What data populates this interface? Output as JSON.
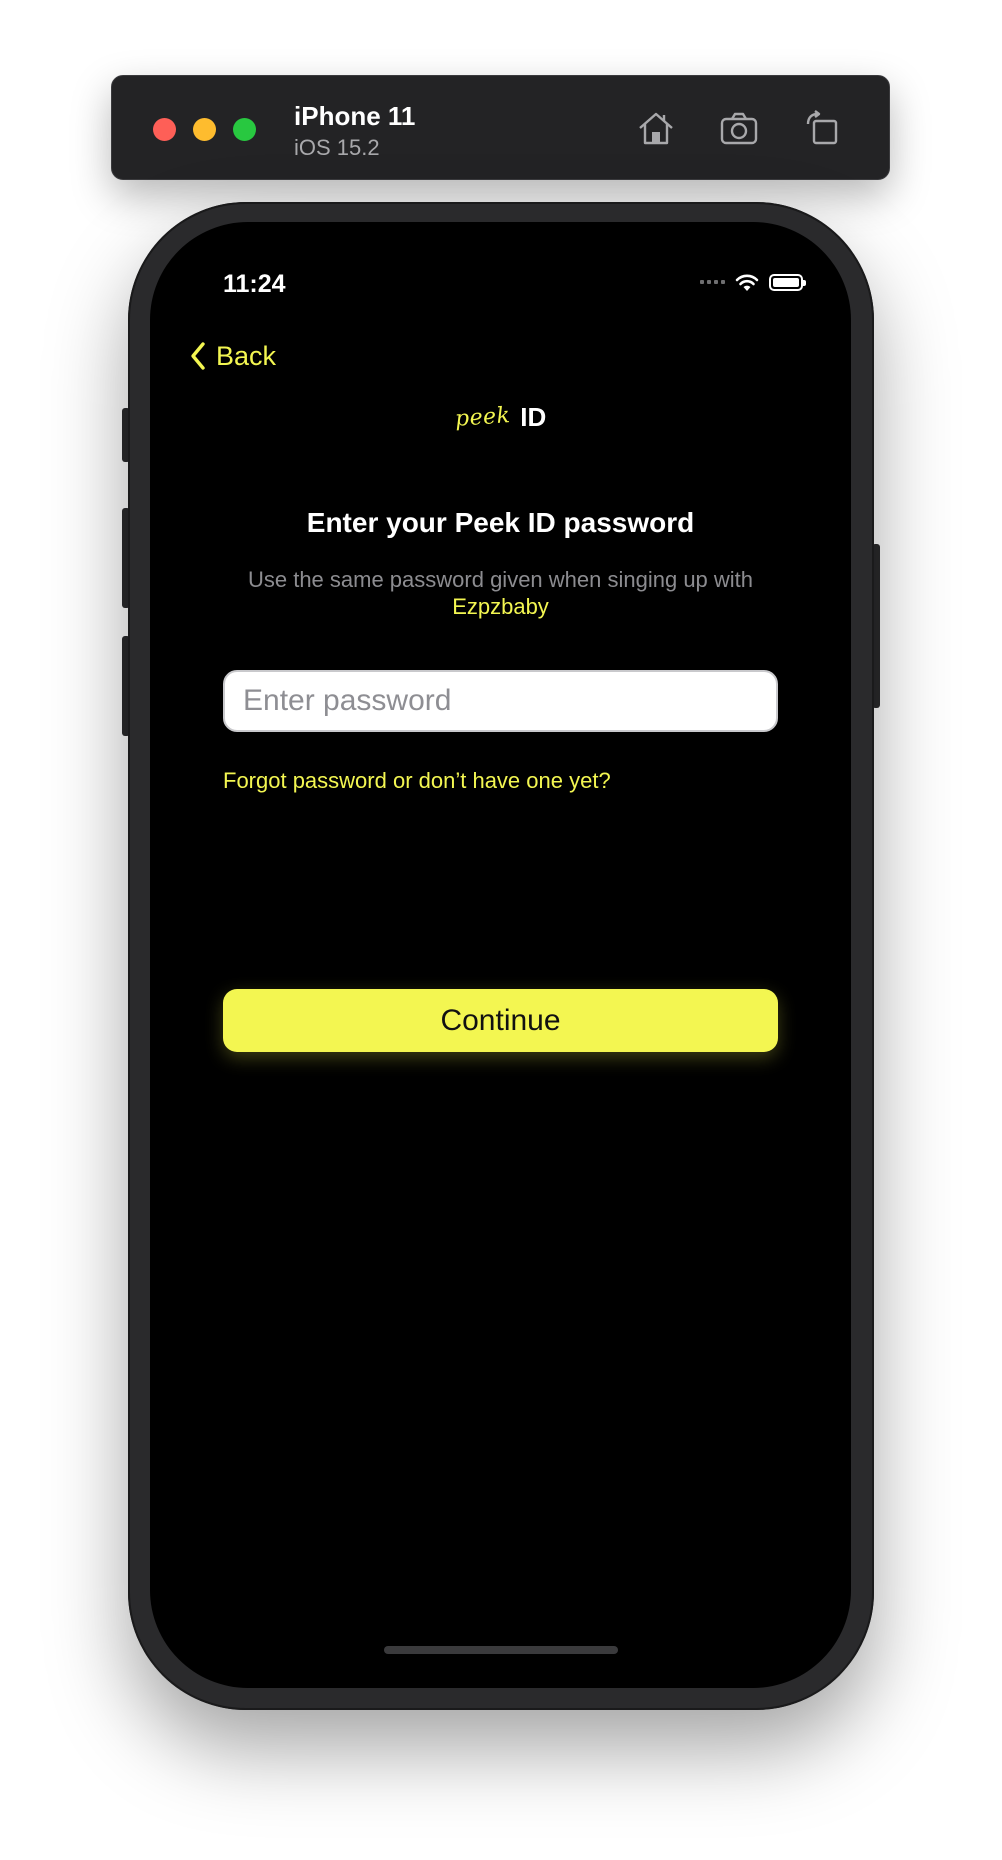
{
  "simulator": {
    "device_name": "iPhone 11",
    "os_version": "iOS 15.2",
    "icons": [
      "home-icon",
      "screenshot-icon",
      "rotate-icon"
    ]
  },
  "status_bar": {
    "time": "11:24",
    "icons": [
      "signal-icon",
      "wifi-icon",
      "battery-icon"
    ]
  },
  "nav": {
    "back_label": "Back"
  },
  "logo": {
    "script": "peek",
    "id": "ID"
  },
  "content": {
    "title": "Enter your Peek ID password",
    "subtitle_text": "Use the same password given when singing up with",
    "subtitle_brand": "Ezpzbaby",
    "password_placeholder": "Enter password",
    "forgot_link": "Forgot password or don’t have one yet?",
    "continue_label": "Continue"
  },
  "colors": {
    "accent": "#f3f651",
    "background": "#000000",
    "toolbar": "#232325"
  }
}
